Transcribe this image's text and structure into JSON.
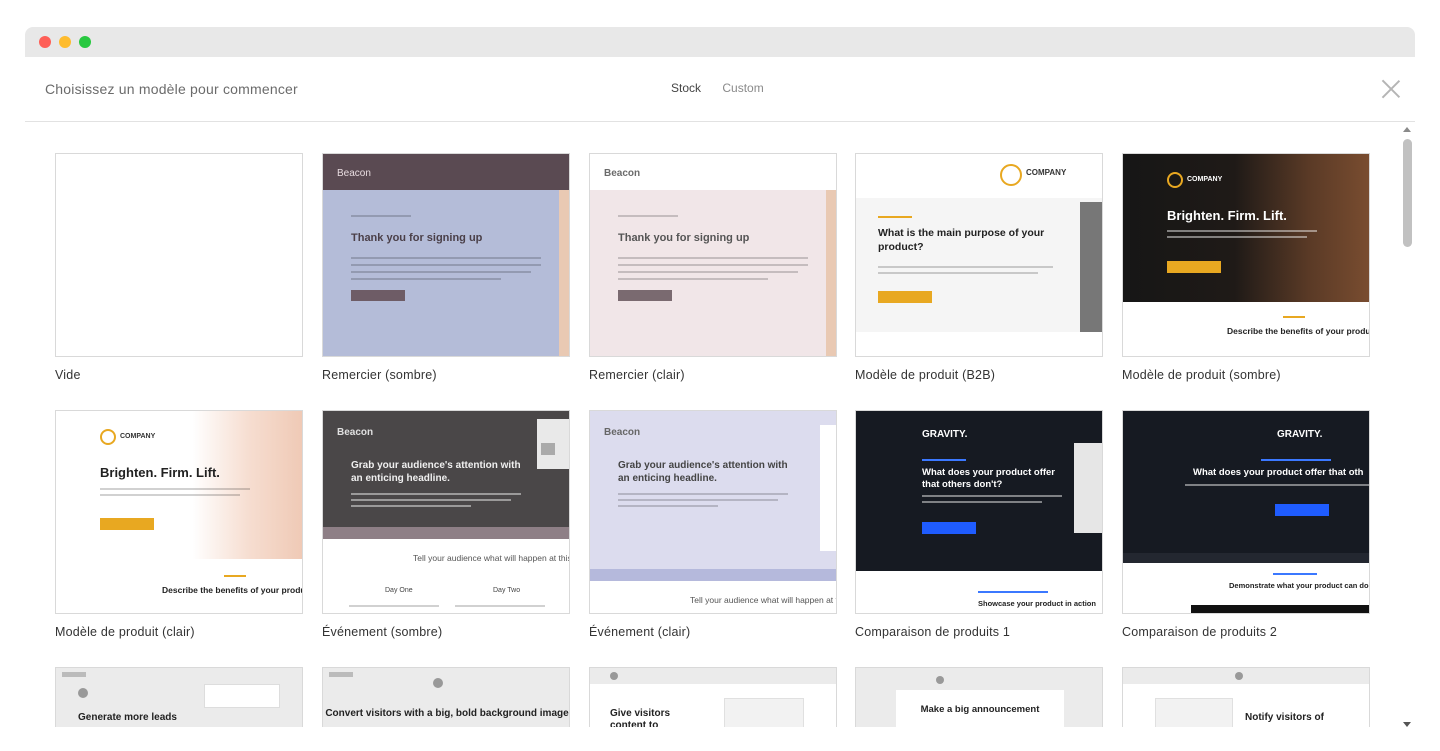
{
  "window": {
    "title": "Choisissez un modèle pour commencer",
    "tabs": [
      "Stock",
      "Custom"
    ]
  },
  "templates": [
    {
      "label": "Vide"
    },
    {
      "label": "Remercier (sombre)",
      "preview": {
        "brand": "Beacon",
        "heading": "Thank you for signing up"
      }
    },
    {
      "label": "Remercier (clair)",
      "preview": {
        "brand": "Beacon",
        "heading": "Thank you for signing up"
      }
    },
    {
      "label": "Modèle de produit (B2B)",
      "preview": {
        "brand": "COMPANY",
        "heading": "What is the main purpose of your product?"
      }
    },
    {
      "label": "Modèle de produit (sombre)",
      "preview": {
        "brand": "COMPANY",
        "heading": "Brighten. Firm. Lift.",
        "sub": "Describe the benefits of your product"
      }
    },
    {
      "label": "Modèle de produit (clair)",
      "preview": {
        "brand": "COMPANY",
        "heading": "Brighten. Firm. Lift.",
        "sub": "Describe the benefits of your produ"
      }
    },
    {
      "label": "Événement (sombre)",
      "preview": {
        "brand": "Beacon",
        "heading": "Grab your audience's attention with an enticing headline.",
        "sub": "Tell your audience what will happen at this m",
        "day_one": "Day One",
        "day_two": "Day Two"
      }
    },
    {
      "label": "Événement (clair)",
      "preview": {
        "brand": "Beacon",
        "heading": "Grab your audience's attention with an enticing headline.",
        "sub": "Tell your audience what will happen at this m"
      }
    },
    {
      "label": "Comparaison de produits 1",
      "preview": {
        "brand": "GRAVITY.",
        "heading": "What does your product offer that others don't?",
        "sub": "Showcase your product in action"
      }
    },
    {
      "label": "Comparaison de produits 2",
      "preview": {
        "brand": "GRAVITY.",
        "heading": "What does your product offer that oth",
        "sub": "Demonstrate what your product can do for y"
      }
    },
    {
      "preview": {
        "heading": "Generate more leads"
      }
    },
    {
      "preview": {
        "heading": "Convert visitors with a big, bold background image"
      }
    },
    {
      "preview": {
        "heading": "Give visitors content to"
      }
    },
    {
      "preview": {
        "heading": "Make a big announcement"
      }
    },
    {
      "preview": {
        "heading": "Notify visitors of"
      }
    }
  ]
}
